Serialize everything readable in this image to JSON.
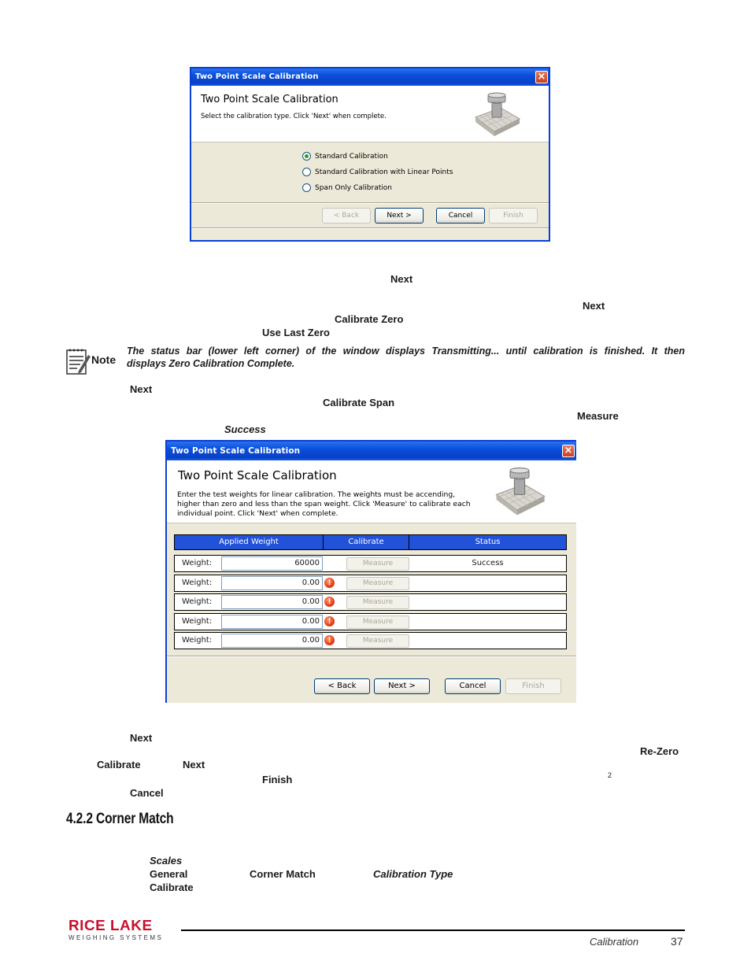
{
  "dialog1": {
    "window_title": "Two Point Scale Calibration",
    "heading": "Two Point Scale Calibration",
    "subtitle": "Select the calibration type. Click 'Next' when complete.",
    "options": [
      {
        "label": "Standard Calibration",
        "selected": true
      },
      {
        "label": "Standard Calibration with Linear Points",
        "selected": false
      },
      {
        "label": "Span Only Calibration",
        "selected": false
      }
    ],
    "buttons": {
      "back": "< Back",
      "next": "Next >",
      "cancel": "Cancel",
      "finish": "Finish"
    }
  },
  "dialog2": {
    "window_title": "Two Point Scale Calibration",
    "heading": "Two Point Scale Calibration",
    "instructions": [
      "Enter the test weights for linear calibration. The weights must be accending,",
      "higher than zero and less than the span weight. Click 'Measure' to calibrate each",
      "individual point. Click 'Next' when complete."
    ],
    "columns": [
      "Applied Weight",
      "Calibrate",
      "Status"
    ],
    "rows": [
      {
        "label": "Weight:",
        "value": "60000",
        "button": "Measure",
        "status": "Success",
        "error": false
      },
      {
        "label": "Weight:",
        "value": "0.00",
        "button": "Measure",
        "status": "",
        "error": true
      },
      {
        "label": "Weight:",
        "value": "0.00",
        "button": "Measure",
        "status": "",
        "error": true
      },
      {
        "label": "Weight:",
        "value": "0.00",
        "button": "Measure",
        "status": "",
        "error": true
      },
      {
        "label": "Weight:",
        "value": "0.00",
        "button": "Measure",
        "status": "",
        "error": true
      }
    ],
    "buttons": {
      "back": "< Back",
      "next": "Next >",
      "cancel": "Cancel",
      "finish": "Finish"
    }
  },
  "text_fragments": {
    "f1": "Next",
    "f2": "Next",
    "f3": "Calibrate Zero",
    "f4": "Use Last Zero",
    "f5": "Next",
    "f6": "Calibrate Span",
    "f7": "Measure",
    "f8": "Success",
    "f9": "Next",
    "f10": "Re-Zero",
    "f11": "Calibrate",
    "f12": "Next",
    "f13": "Finish",
    "f14": "2",
    "f15": "Cancel",
    "f16": "Scales",
    "f17": "General",
    "f18": "Corner Match",
    "f19": "Calibration Type",
    "f20": "Calibrate"
  },
  "note": {
    "label": "Note",
    "line1": "The status bar (lower left corner) of the window displays Transmitting... until calibration is finished. It then",
    "line2": "displays Zero Calibration Complete."
  },
  "section": {
    "title": "4.2.2  Corner Match"
  },
  "footer": {
    "brand_top": "RICE LAKE",
    "brand_bottom": "WEIGHING SYSTEMS",
    "section_name": "Calibration",
    "page_number": "37"
  }
}
